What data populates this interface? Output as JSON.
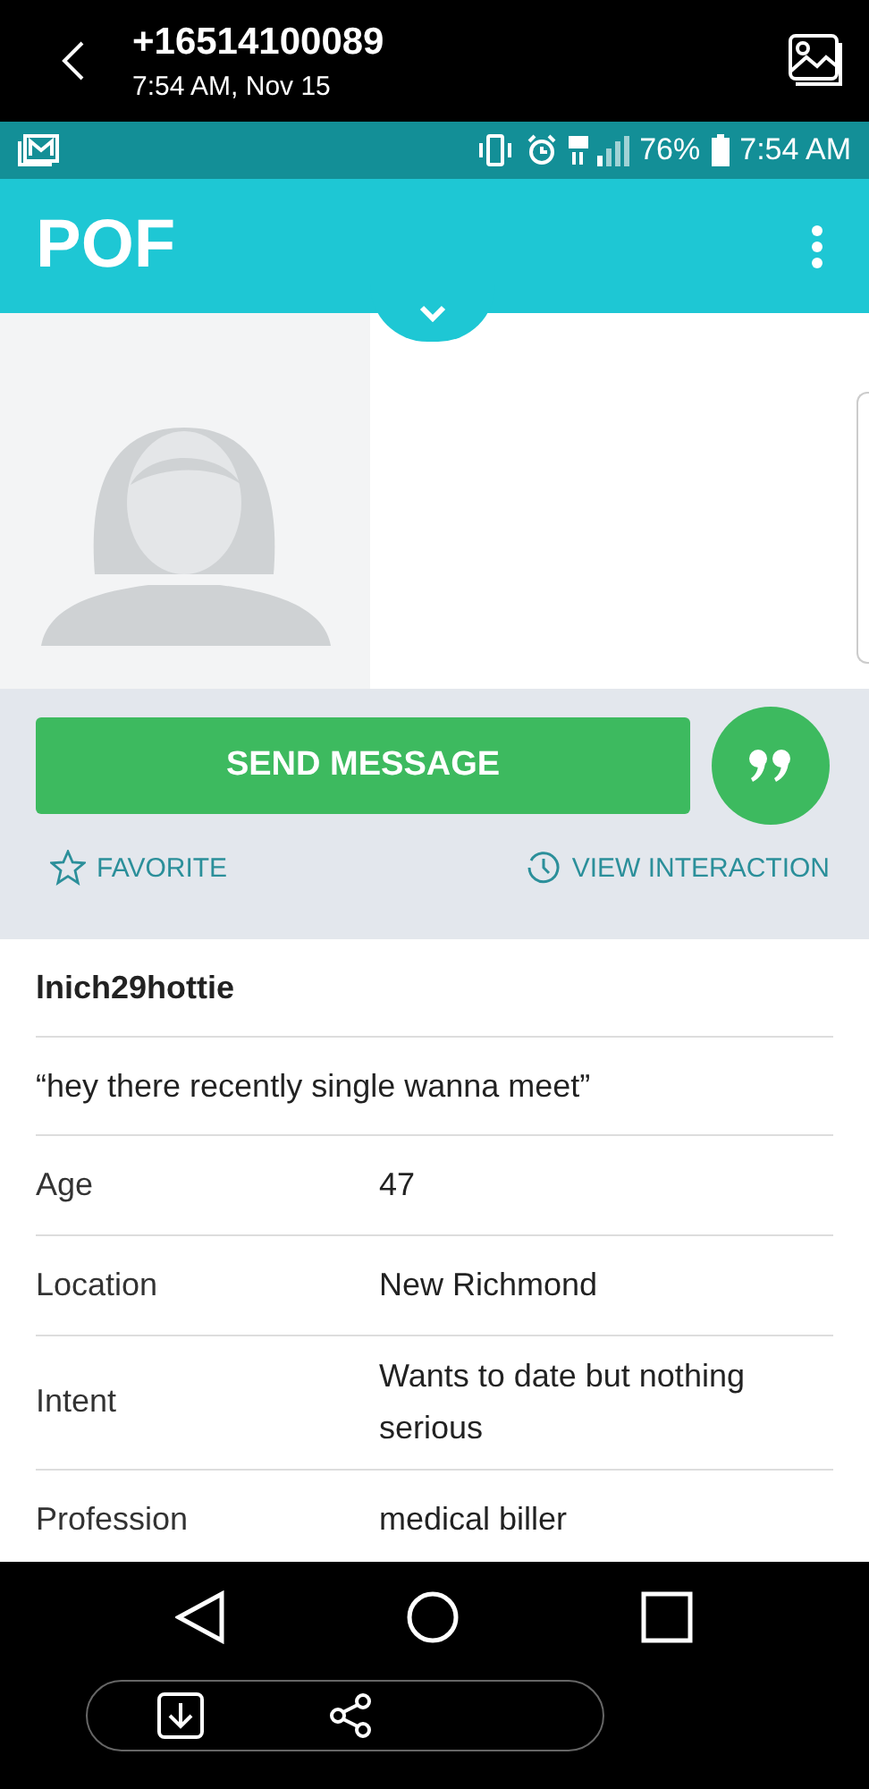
{
  "viewer": {
    "title": "+16514100089",
    "subtitle": "7:54 AM, Nov 15"
  },
  "status_bar": {
    "battery": "76%",
    "time": "7:54 AM"
  },
  "app_bar": {
    "title": "POF"
  },
  "actions": {
    "send_button": "SEND MESSAGE",
    "favorite": "FAVORITE",
    "view_interaction": "VIEW INTERACTION"
  },
  "details": {
    "username": "lnich29hottie",
    "headline": "“hey there recently single wanna meet”",
    "fields": [
      {
        "label": "Age",
        "value": "47"
      },
      {
        "label": "Location",
        "value": "New Richmond"
      },
      {
        "label": "Intent",
        "value": "Wants to date but nothing serious"
      },
      {
        "label": "Profession",
        "value": "medical biller"
      }
    ]
  }
}
